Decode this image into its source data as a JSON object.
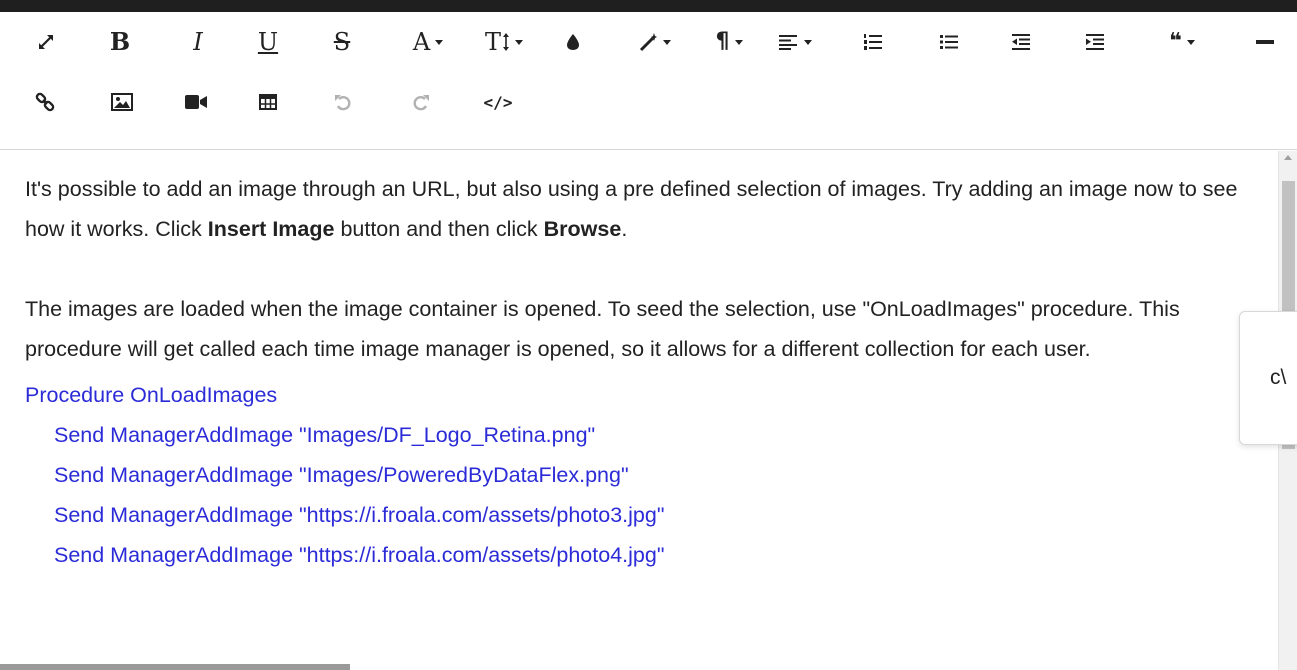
{
  "toolbar": {
    "row1": [
      {
        "name": "fullscreen-button",
        "icon": "expand-icon"
      },
      {
        "name": "bold-button",
        "icon": "bold-icon",
        "label": "B"
      },
      {
        "name": "italic-button",
        "icon": "italic-icon",
        "label": "I"
      },
      {
        "name": "underline-button",
        "icon": "underline-icon",
        "label": "U"
      },
      {
        "name": "strikethrough-button",
        "icon": "strikethrough-icon",
        "label": "S"
      },
      {
        "name": "font-family-dropdown",
        "icon": "font-family-icon",
        "label": "A"
      },
      {
        "name": "font-size-dropdown",
        "icon": "font-size-icon",
        "label": "T"
      },
      {
        "name": "color-button",
        "icon": "droplet-icon"
      },
      {
        "name": "inline-style-dropdown",
        "icon": "magic-wand-icon"
      },
      {
        "name": "paragraph-style-dropdown",
        "icon": "pilcrow-icon",
        "label": "¶"
      },
      {
        "name": "align-dropdown",
        "icon": "align-left-icon"
      },
      {
        "name": "ordered-list-button",
        "icon": "ordered-list-icon"
      },
      {
        "name": "unordered-list-button",
        "icon": "unordered-list-icon"
      },
      {
        "name": "outdent-button",
        "icon": "outdent-icon"
      },
      {
        "name": "indent-button",
        "icon": "indent-icon"
      },
      {
        "name": "quote-dropdown",
        "icon": "quote-icon",
        "label": "❝"
      },
      {
        "name": "horizontal-line-button",
        "icon": "horizontal-line-icon"
      }
    ],
    "row2": [
      {
        "name": "insert-link-button",
        "icon": "link-icon"
      },
      {
        "name": "insert-image-button",
        "icon": "image-icon"
      },
      {
        "name": "insert-video-button",
        "icon": "video-camera-icon"
      },
      {
        "name": "insert-table-button",
        "icon": "table-icon"
      },
      {
        "name": "undo-button",
        "icon": "undo-icon"
      },
      {
        "name": "redo-button",
        "icon": "redo-icon"
      },
      {
        "name": "code-view-button",
        "icon": "code-icon",
        "label": "</>"
      }
    ]
  },
  "content": {
    "p1_part1": "It's possible to add an image through an URL, but also using a pre defined selection of images. Try adding an image now to see how it works. Click ",
    "p1_bold1": "Insert Image",
    "p1_part2": " button and then click ",
    "p1_bold2": "Browse",
    "p1_part3": ".",
    "p2": "The images are loaded when the image container is opened. To seed the selection, use \"OnLoadImages\" procedure. This procedure will get called each time image manager is opened, so it allows for a different collection for each user.",
    "code_lines": [
      "Procedure OnLoadImages",
      "Send ManagerAddImage \"Images/DF_Logo_Retina.png\"",
      "Send ManagerAddImage \"Images/PoweredByDataFlex.png\"",
      "Send ManagerAddImage \"https://i.froala.com/assets/photo3.jpg\"",
      "Send ManagerAddImage \"https://i.froala.com/assets/photo4.jpg\""
    ]
  },
  "popup": {
    "text": "c\\"
  },
  "colors": {
    "link_code": "#2b2bd8",
    "text": "#222222",
    "toolbar_border": "#d6d6d6",
    "topbar": "#1f1f1f"
  }
}
